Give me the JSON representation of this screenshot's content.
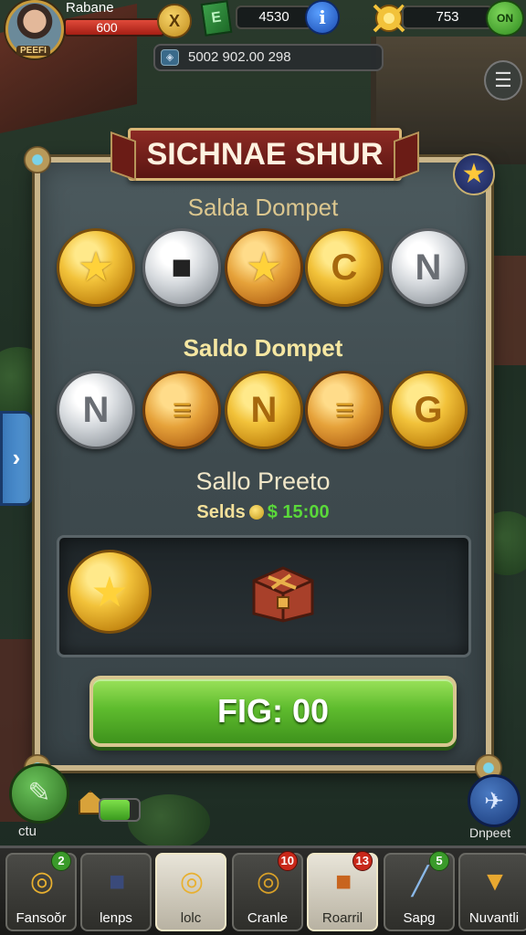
{
  "player": {
    "name": "Rabane",
    "hp_text": "600",
    "avatar_tag": "PEEFI"
  },
  "top": {
    "coin_btn_glyph": "X",
    "gem_glyph": "E",
    "resource1": "4530",
    "info_glyph": "i",
    "resource2": "753",
    "green_btn_label": "ON",
    "address": "5002 902.00 298",
    "menu_glyph": "☰"
  },
  "modal": {
    "banner_title": "SICHNAE SHUR",
    "section1_title": "Salda Dompet",
    "section2_title": "Saldo Dompet",
    "section3_title": "Sallo Preeto",
    "sub_label": "Selds",
    "sub_value": "$ 15:00",
    "row1": [
      {
        "kind": "gold",
        "glyph": "★",
        "glyph_class": "star"
      },
      {
        "kind": "silver",
        "glyph": "■",
        "glyph_class": "box"
      },
      {
        "kind": "bronze",
        "glyph": "★",
        "glyph_class": "star"
      },
      {
        "kind": "gold",
        "glyph": "C",
        "glyph_class": ""
      },
      {
        "kind": "silver",
        "glyph": "N",
        "glyph_class": ""
      }
    ],
    "row2": [
      {
        "kind": "silver",
        "glyph": "N",
        "glyph_class": ""
      },
      {
        "kind": "bronze",
        "glyph": "≡",
        "glyph_class": "stack"
      },
      {
        "kind": "gold",
        "glyph": "N",
        "glyph_class": ""
      },
      {
        "kind": "bronze",
        "glyph": "≡",
        "glyph_class": "stack"
      },
      {
        "kind": "gold",
        "glyph": "G",
        "glyph_class": ""
      }
    ],
    "big_coin_glyph": "★",
    "action_label": "FIG: 00"
  },
  "side": {
    "arrow_glyph": "›",
    "left_label": "ctu",
    "left_glyph": "✎",
    "progress": 0.75,
    "right_label": "Dnpeet",
    "right_glyph": "✈"
  },
  "dock": [
    {
      "label": "Fansoŏr",
      "icon": "coins-icon",
      "glyph": "◎",
      "color": "#e8b030",
      "badge": "2",
      "badge_color": "green"
    },
    {
      "label": "lenps",
      "icon": "chest-icon",
      "glyph": "■",
      "color": "#3a4a7a",
      "badge": "",
      "badge_color": ""
    },
    {
      "label": "lolc",
      "icon": "coins-stack-icon",
      "glyph": "◎",
      "color": "#e8b030",
      "badge": "",
      "badge_color": "",
      "active": true
    },
    {
      "label": "Cranle",
      "icon": "gold-stack-icon",
      "glyph": "◎",
      "color": "#d8a028",
      "badge": "10",
      "badge_color": "red"
    },
    {
      "label": "Roarril",
      "icon": "treasure-chest-icon",
      "glyph": "■",
      "color": "#c8641e",
      "badge": "13",
      "badge_color": "red",
      "active": true
    },
    {
      "label": "Sapg",
      "icon": "flashlight-icon",
      "glyph": "╱",
      "color": "#8ab8e8",
      "badge": "5",
      "badge_color": "green"
    },
    {
      "label": "Nuvantli",
      "icon": "torch-icon",
      "glyph": "▼",
      "color": "#e8a830",
      "badge": "",
      "badge_color": ""
    }
  ],
  "colors": {
    "accent_green": "#5fbc2e",
    "banner_red": "#8c2a24",
    "frame_gold": "#c9b58a"
  }
}
